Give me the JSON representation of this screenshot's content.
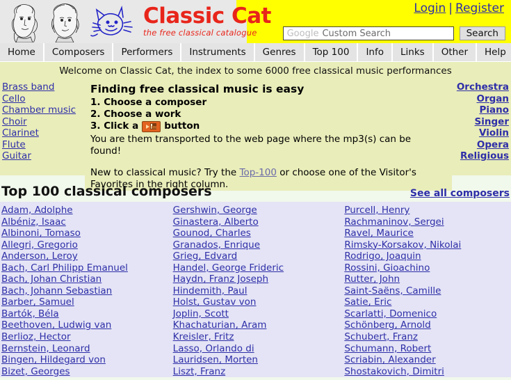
{
  "header": {
    "brand_title": "Classic Cat",
    "brand_subtitle": "the free classical catalogue",
    "portrait_1": "handel-portrait",
    "portrait_2": "bach-portrait",
    "cat_logo": "cat-logo",
    "login_label": "Login",
    "auth_separator": "|",
    "register_label": "Register",
    "search": {
      "google_word": "Google",
      "placeholder_text": "Custom Search",
      "button_label": "Search",
      "value": ""
    }
  },
  "nav": {
    "items": [
      {
        "label": "Home"
      },
      {
        "label": "Composers"
      },
      {
        "label": "Performers"
      },
      {
        "label": "Instruments"
      },
      {
        "label": "Genres"
      },
      {
        "label": "Top 100"
      },
      {
        "label": "Info"
      },
      {
        "label": "Links"
      },
      {
        "label": "Other"
      },
      {
        "label": "Help"
      }
    ]
  },
  "welcome": {
    "text": "Welcome on Classic Cat, the index to some 6000 free classical music performances"
  },
  "left_sidebar": {
    "items": [
      {
        "label": "Brass band"
      },
      {
        "label": "Cello"
      },
      {
        "label": "Chamber music"
      },
      {
        "label": "Choir"
      },
      {
        "label": "Clarinet"
      },
      {
        "label": "Flute"
      },
      {
        "label": "Guitar"
      }
    ]
  },
  "right_sidebar": {
    "items": [
      {
        "label": "Orchestra"
      },
      {
        "label": "Organ"
      },
      {
        "label": "Piano"
      },
      {
        "label": "Singer"
      },
      {
        "label": "Violin"
      },
      {
        "label": "Opera"
      },
      {
        "label": "Religious"
      }
    ]
  },
  "intro": {
    "title": "Finding free classical music is easy",
    "step1": "1. Choose a composer",
    "step2": "2. Choose a work",
    "step3_prefix": "3. Click a",
    "step3_suffix": "button",
    "step3_icon": "download-save-button-icon",
    "note": "You are them transported to the web page where the mp3(s) can be found!",
    "para_prefix": "New to classical music? Try the",
    "para_link": "Top-100",
    "para_suffix": "or choose one of the Visitor's",
    "para_line2": "Favorites in the right column."
  },
  "top100": {
    "title": "Top 100 classical composers",
    "see_all_label": "See all composers",
    "columns": [
      {
        "composers": [
          "Adam, Adolphe",
          "Albéniz, Isaac",
          "Albinoni, Tomaso",
          "Allegri, Gregorio",
          "Anderson, Leroy",
          "Bach, Carl Philipp Emanuel",
          "Bach, Johan Christian",
          "Bach, Johann Sebastian",
          "Barber, Samuel",
          "Bartók, Béla",
          "Beethoven, Ludwig van",
          "Berlioz, Hector",
          "Bernstein, Leonard",
          "Bingen, Hildegard von",
          "Bizet, Georges"
        ]
      },
      {
        "composers": [
          "Gershwin, George",
          "Ginastera, Alberto",
          "Gounod, Charles",
          "Granados, Enrique",
          "Grieg, Edvard",
          "Handel, George Frideric",
          "Haydn, Franz Joseph",
          "Hindemith, Paul",
          "Holst, Gustav von",
          "Joplin, Scott",
          "Khachaturian, Aram",
          "Kreisler, Fritz",
          "Lasso, Orlando di",
          "Lauridsen, Morten",
          "Liszt, Franz"
        ]
      },
      {
        "composers": [
          "Purcell, Henry",
          "Rachmaninov, Sergei",
          "Ravel, Maurice",
          "Rimsky-Korsakov, Nikolai",
          "Rodrigo, Joaquin",
          "Rossini, Gioachino",
          "Rutter, John",
          "Saint-Saëns, Camille",
          "Satie, Eric",
          "Scarlatti, Domenico",
          "Schönberg, Arnold",
          "Schubert, Franz",
          "Schumann, Robert",
          "Scriabin, Alexander",
          "Shostakovich, Dimitri"
        ]
      }
    ]
  },
  "colors": {
    "brand_red": "#e8251b",
    "link_blue": "#2e2ea8",
    "header_yellow": "#ffff00",
    "banner_olive": "#e9edb9",
    "table_lavender": "#e4e4f6",
    "page_green": "#f1f8ec"
  }
}
